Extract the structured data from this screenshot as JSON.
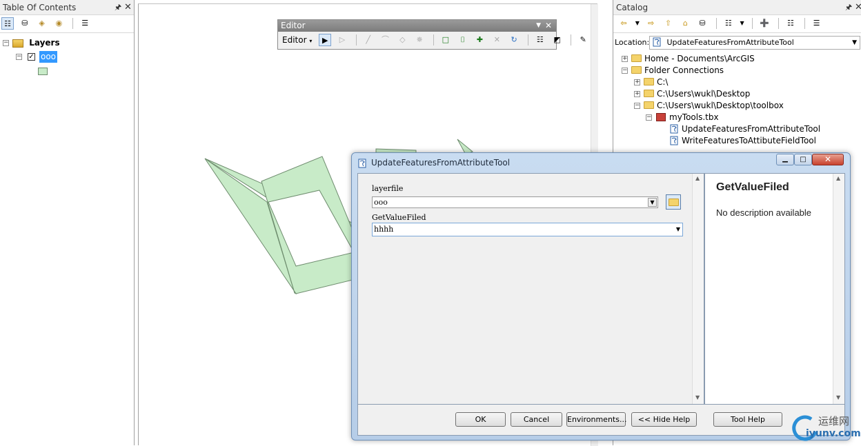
{
  "toc": {
    "title": "Table Of Contents",
    "root_label": "Layers",
    "layer_label": "ooo"
  },
  "editor_toolbar": {
    "title": "Editor",
    "menu_label": "Editor"
  },
  "catalog": {
    "title": "Catalog",
    "location_label": "Location:",
    "location_value": "UpdateFeaturesFromAttributeTool",
    "tree": [
      {
        "label": "Home - Documents\\ArcGIS"
      },
      {
        "label": "Folder Connections"
      },
      {
        "label": "C:\\"
      },
      {
        "label": "C:\\Users\\wukl\\Desktop"
      },
      {
        "label": "C:\\Users\\wukl\\Desktop\\toolbox"
      },
      {
        "label": "myTools.tbx"
      },
      {
        "label": "UpdateFeaturesFromAttributeTool"
      },
      {
        "label": "WriteFeaturesToAttibuteFieldTool"
      }
    ]
  },
  "dialog": {
    "title": "UpdateFeaturesFromAttributeTool",
    "param1_label": "layerfile",
    "param1_value": "ooo",
    "param2_label": "GetValueFiled",
    "param2_value": "hhhh",
    "help_title": "GetValueFiled",
    "help_text": "No description available",
    "buttons": {
      "ok": "OK",
      "cancel": "Cancel",
      "environments": "Environments...",
      "hide_help": "<< Hide Help",
      "tool_help": "Tool Help"
    }
  },
  "watermark": {
    "cn": "运维网",
    "url": "iyunv.com"
  },
  "colors": {
    "polygon_fill": "#c8ebc8",
    "polygon_stroke": "#6e8c6e",
    "selection": "#3399ff",
    "dialog_border": "#6d8fb7"
  }
}
